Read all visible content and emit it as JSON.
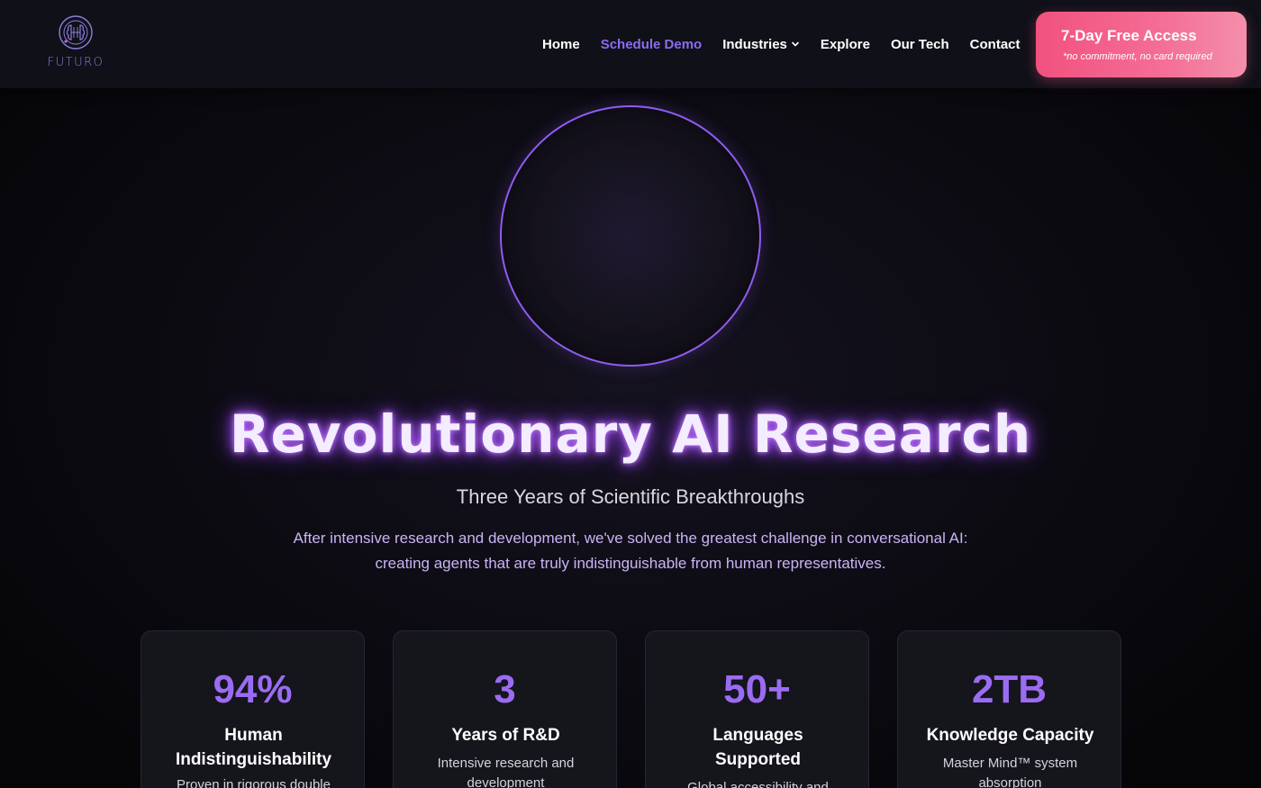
{
  "brand": {
    "name": "FUTURO"
  },
  "nav": {
    "items": [
      {
        "label": "Home"
      },
      {
        "label": "Schedule Demo"
      },
      {
        "label": "Industries"
      },
      {
        "label": "Explore"
      },
      {
        "label": "Our Tech"
      },
      {
        "label": "Contact"
      }
    ]
  },
  "cta": {
    "title": "7-Day Free Access",
    "subtitle": "*no commitment, no card required"
  },
  "hero": {
    "title": "Revolutionary AI Research",
    "subtitle": "Three Years of Scientific Breakthroughs",
    "description": "After intensive research and development, we've solved the greatest challenge in conversational AI: creating agents that are truly indistinguishable from human representatives."
  },
  "stats": [
    {
      "value": "94%",
      "label": "Human Indistinguishability",
      "desc": "Proven in rigorous double"
    },
    {
      "value": "3",
      "label": "Years of R&D",
      "desc": "Intensive research and development"
    },
    {
      "value": "50+",
      "label": "Languages Supported",
      "desc": "Global accessibility and"
    },
    {
      "value": "2TB",
      "label": "Knowledge Capacity",
      "desc": "Master Mind™ system absorption"
    }
  ],
  "colors": {
    "accent": "#8b6cf0",
    "cta": "#f2517f",
    "orb_ring": "#8e5cf0",
    "glow": "#a855f7"
  },
  "icons": {
    "logo": "brain-circuit-icon",
    "industries_dropdown": "chevron-down-icon"
  }
}
